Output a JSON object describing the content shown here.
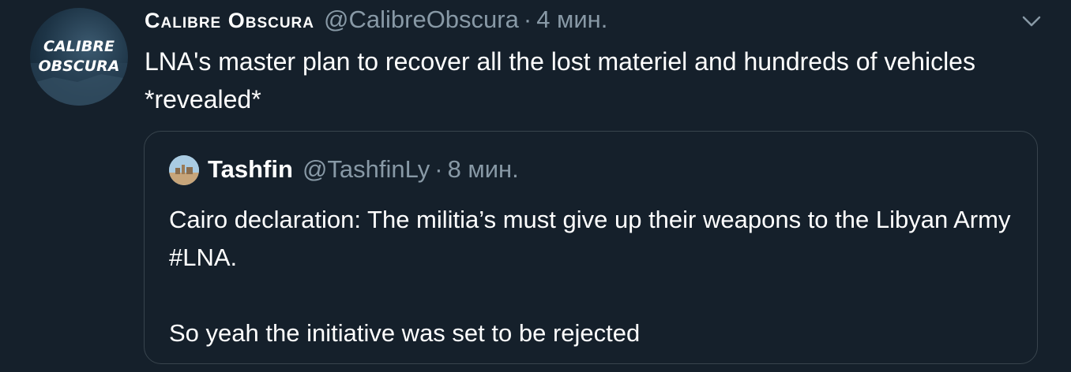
{
  "tweet": {
    "display_name": "Calibre Obscura",
    "handle": "@CalibreObscura",
    "separator": "·",
    "time": "4 мин.",
    "text": "LNA's master plan to recover all the lost materiel and hundreds of vehicles *revealed*",
    "avatar": {
      "line1": "CALIBRE",
      "line2": "OBSCURA"
    },
    "menu_icon": "chevron-down-icon"
  },
  "quoted_tweet": {
    "display_name": "Tashfin",
    "handle": "@TashfinLy",
    "separator": "·",
    "time": "8 мин.",
    "text_line1": "Cairo declaration: The militia’s must give up their weapons to the Libyan Army #LNA.",
    "text_line2": "So yeah the initiative was set to be rejected"
  },
  "colors": {
    "background": "#15202b",
    "text_primary": "#ffffff",
    "text_secondary": "#8899a6",
    "border": "#38444d"
  }
}
